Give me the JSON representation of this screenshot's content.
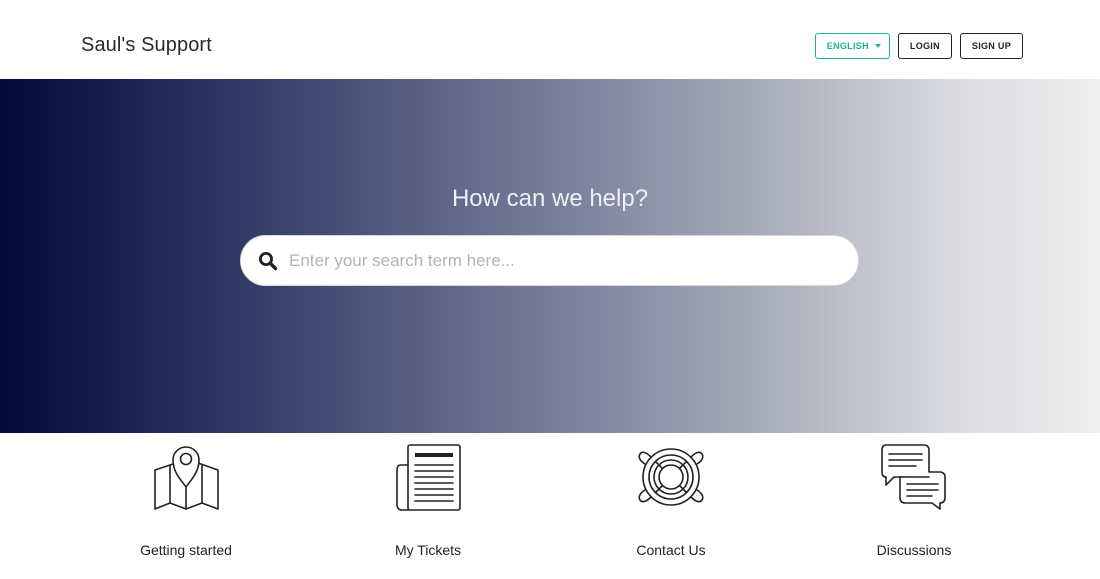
{
  "header": {
    "brand": "Saul's Support",
    "language_label": "ENGLISH",
    "login_label": "LOGIN",
    "signup_label": "SIGN UP"
  },
  "hero": {
    "title": "How can we help?",
    "search": {
      "placeholder": "Enter your search term here...",
      "value": "",
      "icon": "search-icon"
    }
  },
  "categories": [
    {
      "label": "Getting started",
      "icon": "map-pin-icon"
    },
    {
      "label": "My Tickets",
      "icon": "document-icon"
    },
    {
      "label": "Contact Us",
      "icon": "lifebuoy-icon"
    },
    {
      "label": "Discussions",
      "icon": "chat-bubbles-icon"
    }
  ],
  "colors": {
    "accent": "#1bb394",
    "hero_gradient_start": "#010a3b",
    "hero_gradient_end": "#efefef",
    "text": "#222222"
  }
}
